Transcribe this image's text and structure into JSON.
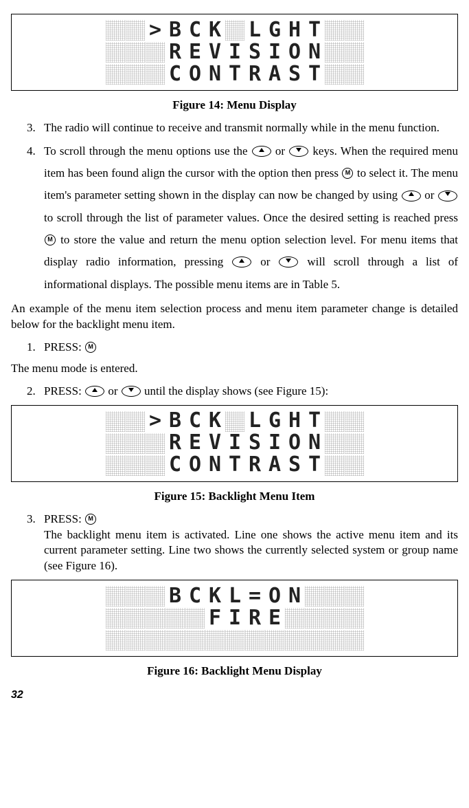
{
  "figures": {
    "fig14": {
      "caption": "Figure 14: Menu Display",
      "lines": [
        ">BCK LGHT",
        " REVISION",
        " CONTRAST"
      ]
    },
    "fig15": {
      "caption": "Figure 15: Backlight Menu Item",
      "lines": [
        ">BCK LGHT",
        " REVISION",
        " CONTRAST"
      ]
    },
    "fig16": {
      "caption": "Figure 16: Backlight Menu Display",
      "lines": [
        " BCKL=ON ",
        "   FIRE   ",
        "            "
      ]
    }
  },
  "text": {
    "step3": "The radio will continue to receive and transmit normally while in the menu function.",
    "step4": {
      "p1a": "To scroll through the menu options use the ",
      "p1b": " or ",
      "p1c": " keys.  When the required menu item has been found align the cursor with the option then press ",
      "p1d": " to select it. The menu item's parameter setting shown in the display can now be changed by using ",
      "p1e": " or ",
      "p1f": " to scroll through the list of parameter values. Once the desired setting is reached press ",
      "p1g": " to store the value and return the menu option selection level. For menu items that display radio information, pressing ",
      "p1h": " or ",
      "p1i": " will scroll through a list of informational displays.  The possible menu items are in Table 5."
    },
    "para_example": "An example of the menu item selection process and menu item parameter change is detailed below for the backlight menu item.",
    "s1_label": "PRESS:  ",
    "s1_after": "The menu mode is entered.",
    "s2_a": "PRESS: ",
    "s2_b": " or ",
    "s2_c": " until the display shows (see Figure 15):",
    "s3_a": "PRESS:  ",
    "s3_b": "The backlight menu item is activated.  Line one shows the active menu item and its current parameter setting.  Line two shows the currently selected system or group name (see Figure 16).",
    "page_num": "32",
    "key_m": "M"
  }
}
